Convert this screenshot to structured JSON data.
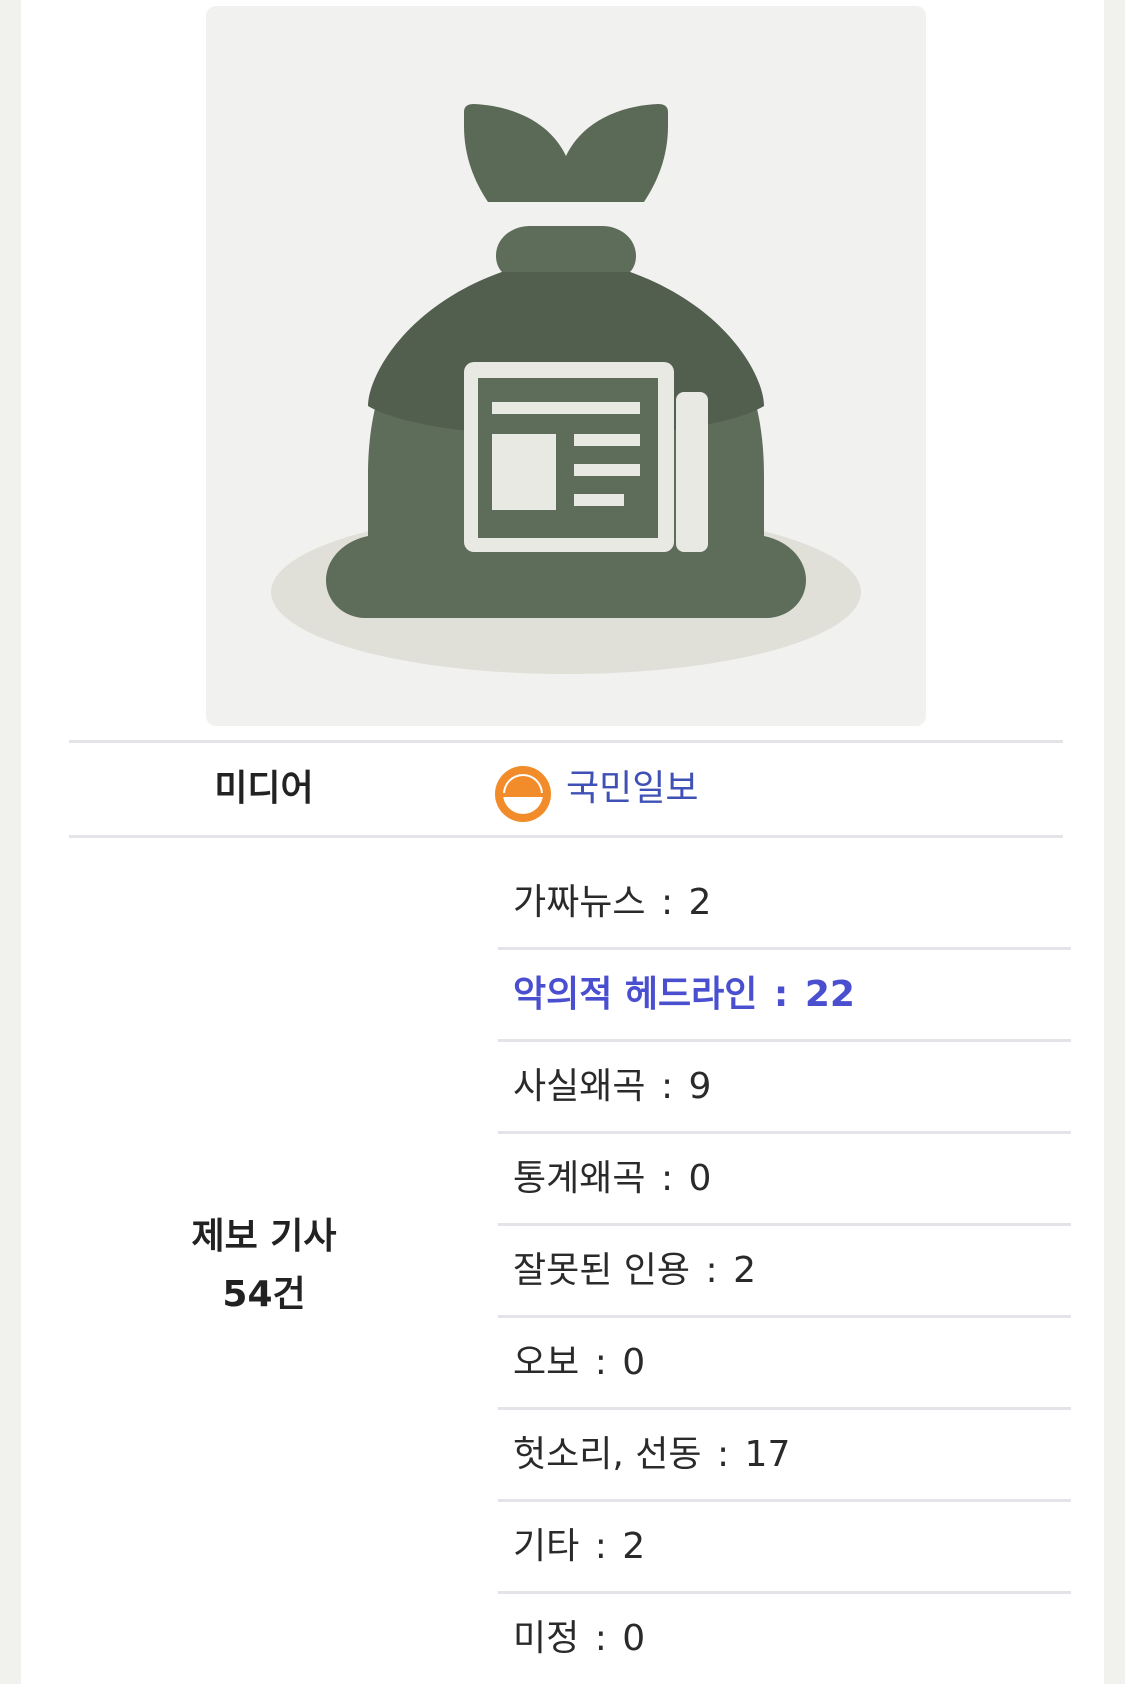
{
  "media": {
    "label": "미디어",
    "name": "국민일보",
    "logo_icon": "kukmin-ilbo-logo-icon",
    "logo_color": "#f28b2a",
    "link_color": "#3f51b5"
  },
  "hero": {
    "icon": "newspaper-trash-bag-icon",
    "bag_color": "#5b6a56",
    "background": "#f1f1ef"
  },
  "reports": {
    "label_line1": "제보 기사",
    "label_line2": "54건",
    "active_color": "#4a4fd0",
    "categories": [
      {
        "name": "가짜뉴스",
        "count": "2",
        "active": false
      },
      {
        "name": "악의적 헤드라인",
        "count": "22",
        "active": true
      },
      {
        "name": "사실왜곡",
        "count": "9",
        "active": false
      },
      {
        "name": "통계왜곡",
        "count": "0",
        "active": false
      },
      {
        "name": "잘못된 인용",
        "count": "2",
        "active": false
      },
      {
        "name": "오보",
        "count": "0",
        "active": false
      },
      {
        "name": "헛소리, 선동",
        "count": "17",
        "active": false
      },
      {
        "name": "기타",
        "count": "2",
        "active": false
      },
      {
        "name": "미정",
        "count": "0",
        "active": false
      }
    ]
  }
}
